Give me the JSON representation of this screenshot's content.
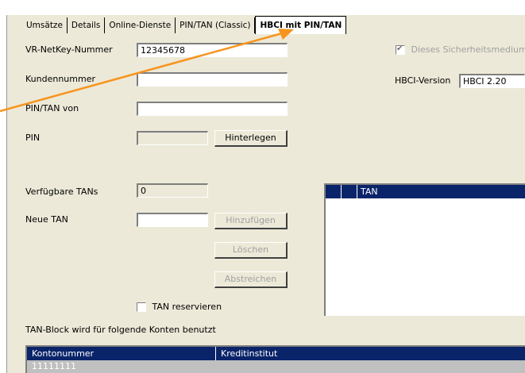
{
  "tabs": [
    {
      "label": "Umsätze"
    },
    {
      "label": "Details"
    },
    {
      "label": "Online-Dienste"
    },
    {
      "label": "PIN/TAN (Classic)"
    },
    {
      "label": "HBCI mit PIN/TAN"
    }
  ],
  "form": {
    "vr_netkey_label": "VR-NetKey-Nummer",
    "vr_netkey_value": "12345678",
    "kundennummer_label": "Kundennummer",
    "kundennummer_value": "",
    "pintan_von_label": "PIN/TAN von",
    "pintan_von_value": "",
    "pin_label": "PIN",
    "pin_value": "",
    "hinterlegen_label": "Hinterlegen",
    "sicherheitsmedium_label": "Dieses Sicherheitsmedium",
    "sicherheitsmedium_checked": true,
    "hbci_version_label": "HBCI-Version",
    "hbci_version_value": "HBCI 2.20"
  },
  "tan": {
    "verfuegbare_label": "Verfügbare TANs",
    "verfuegbare_value": "0",
    "neue_tan_label": "Neue TAN",
    "neue_tan_value": "",
    "hinzufuegen_label": "Hinzufügen",
    "loeschen_label": "Löschen",
    "abstreichen_label": "Abstreichen",
    "reservieren_label": "TAN reservieren",
    "reservieren_checked": false,
    "list_header": "TAN"
  },
  "konten": {
    "caption": "TAN-Block wird für folgende Konten benutzt",
    "columns": [
      "Kontonummer",
      "Kreditinstitut"
    ],
    "rows": [
      [
        "11111111",
        ""
      ]
    ]
  },
  "colors": {
    "highlight_arrow": "#f7941d",
    "header_bg": "#0a246a"
  }
}
